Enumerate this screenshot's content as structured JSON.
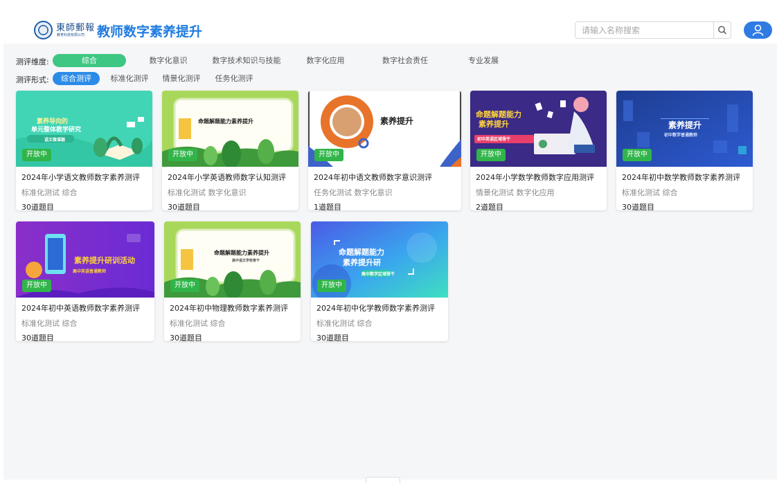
{
  "header": {
    "logo_calligraphy": "東師郵報",
    "logo_subtext": "教育科技有限公司",
    "title": "教师数字素养提升",
    "search_placeholder": "请输入名称搜索"
  },
  "filters": {
    "dimension_label": "测评维度:",
    "dimension_options": [
      "综合",
      "数字化意识",
      "数字技术知识与技能",
      "数字化应用",
      "数字社会责任",
      "专业发展"
    ],
    "dimension_selected": "综合",
    "format_label": "测评形式:",
    "format_options": [
      "综合测评",
      "标准化测评",
      "情景化测评",
      "任务化测评"
    ],
    "format_selected": "综合测评"
  },
  "cards": [
    {
      "title": "2024年小学语文教师数字素养测评",
      "tags": "标准化测试 综合",
      "count": "30道题目",
      "status": "开放中",
      "image_text": [
        "素养导向的",
        "单元整体教学研究",
        "语文微课题"
      ]
    },
    {
      "title": "2024年小学英语教师数字认知测评",
      "tags": "标准化测试 数字化意识",
      "count": "30道题目",
      "status": "开放中",
      "image_text": [
        "命题解题能力素养提升"
      ]
    },
    {
      "title": "2024年初中语文教师数字意识测评",
      "tags": "任务化测试 数字化意识",
      "count": "1道题目",
      "status": "开放中",
      "image_text": [
        "素养提升"
      ]
    },
    {
      "title": "2024年小学数学教师数字应用测评",
      "tags": "情景化测试 数字化应用",
      "count": "2道题目",
      "status": "开放中",
      "image_text": [
        "命题解题能力",
        "素养提升",
        "初中英语区域骨干"
      ]
    },
    {
      "title": "2024年初中数学教师数字素养测评",
      "tags": "标准化测试 综合",
      "count": "30道题目",
      "status": "开放中",
      "image_text": [
        "素养提升",
        "初中数学普通教师"
      ]
    },
    {
      "title": "2024年初中英语教师数字素养测评",
      "tags": "标准化测试 综合",
      "count": "30道题目",
      "status": "开放中",
      "image_text": [
        "素养提升研训活动",
        "高中英语普通教师"
      ]
    },
    {
      "title": "2024年初中物理教师数字素养测评",
      "tags": "标准化测试 综合",
      "count": "30道题目",
      "status": "开放中",
      "image_text": [
        "命题解题能力素养提升",
        "高中语文学校骨干"
      ]
    },
    {
      "title": "2024年初中化学教师数字素养测评",
      "tags": "标准化测试 综合",
      "count": "30道题目",
      "status": "开放中",
      "image_text": [
        "命题解题能力",
        "素养提升研",
        "高中数学区域骨干"
      ]
    }
  ],
  "colors": {
    "brand": "#1e7be0",
    "active_green": "#3ec782",
    "active_blue": "#2b8be8",
    "badge_green": "#31b54a",
    "page_bg": "#f5f6f8"
  }
}
